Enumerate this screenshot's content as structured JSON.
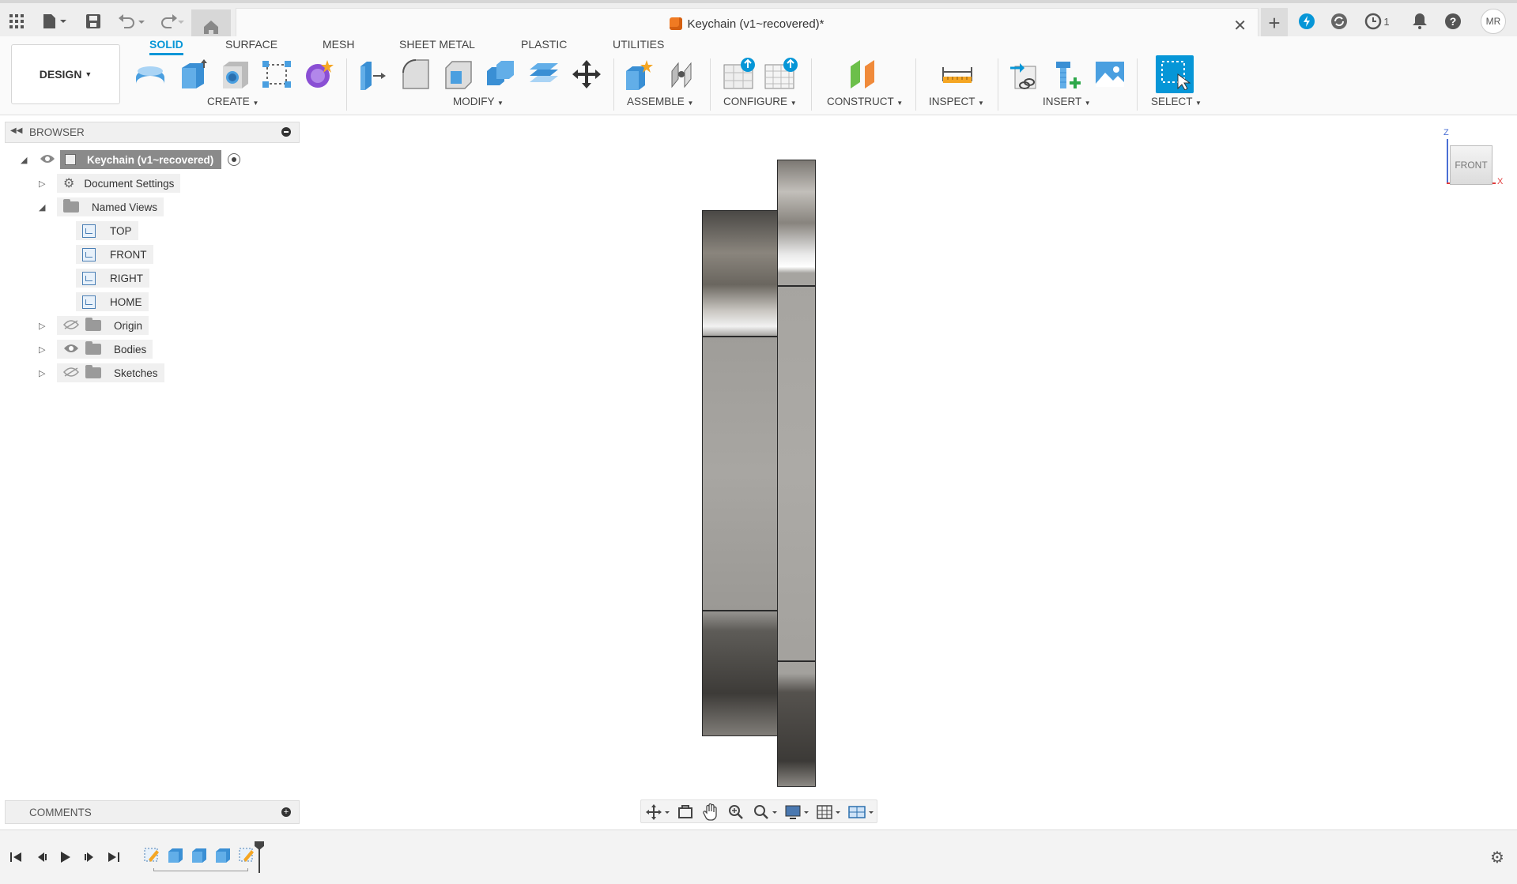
{
  "appbar": {
    "doc_title": "Keychain (v1~recovered)*",
    "user_initials": "MR",
    "jobs_count": "1"
  },
  "ribbon": {
    "workspace": "DESIGN",
    "tabs": [
      "SOLID",
      "SURFACE",
      "MESH",
      "SHEET METAL",
      "PLASTIC",
      "UTILITIES"
    ],
    "active_tab": "SOLID",
    "groups": [
      "CREATE",
      "MODIFY",
      "ASSEMBLE",
      "CONFIGURE",
      "CONSTRUCT",
      "INSPECT",
      "INSERT",
      "SELECT"
    ]
  },
  "browser": {
    "title": "BROWSER",
    "root": "Keychain (v1~recovered)",
    "items": [
      {
        "label": "Document Settings"
      },
      {
        "label": "Named Views"
      },
      {
        "label": "TOP"
      },
      {
        "label": "FRONT"
      },
      {
        "label": "RIGHT"
      },
      {
        "label": "HOME"
      },
      {
        "label": "Origin"
      },
      {
        "label": "Bodies"
      },
      {
        "label": "Sketches"
      }
    ]
  },
  "comments": {
    "title": "COMMENTS"
  },
  "viewcube": {
    "face": "FRONT",
    "axis_z": "Z",
    "axis_x": "X"
  },
  "colors": {
    "accent": "#0696d7",
    "metal_dark": "#4a4845",
    "metal_light": "#d7d5d0"
  }
}
